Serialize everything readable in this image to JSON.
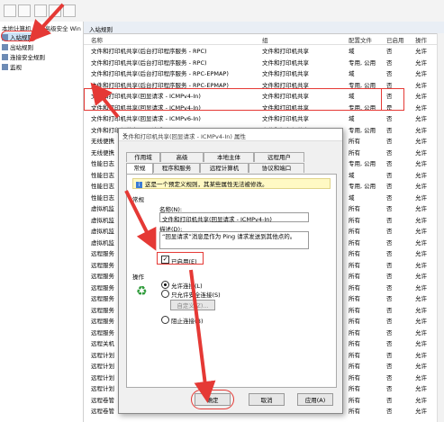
{
  "window": {
    "title": "高级安全 Win"
  },
  "tree": {
    "title": "本地计算机 上的高级安全 Win",
    "items": [
      {
        "label": "入站规则",
        "selected": true
      },
      {
        "label": "出站规则",
        "selected": false
      },
      {
        "label": "连接安全规则",
        "selected": false
      },
      {
        "label": "监视",
        "selected": false
      }
    ]
  },
  "main": {
    "header": "入站规则",
    "columns": {
      "name": "名称",
      "group": "组",
      "profile": "配置文件",
      "enabled": "已启用",
      "action": "操作"
    },
    "rows": [
      {
        "name": "文件和打印机共享(后台打印程序服务 - RPC)",
        "group": "文件和打印机共享",
        "profile": "域",
        "enabled": "否",
        "action": "允许"
      },
      {
        "name": "文件和打印机共享(后台打印程序服务 - RPC)",
        "group": "文件和打印机共享",
        "profile": "专用, 公用",
        "enabled": "否",
        "action": "允许"
      },
      {
        "name": "文件和打印机共享(后台打印程序服务 - RPC-EPMAP)",
        "group": "文件和打印机共享",
        "profile": "域",
        "enabled": "否",
        "action": "允许"
      },
      {
        "name": "文件和打印机共享(后台打印程序服务 - RPC-EPMAP)",
        "group": "文件和打印机共享",
        "profile": "专用, 公用",
        "enabled": "否",
        "action": "允许"
      },
      {
        "name": "文件和打印机共享(回显请求 - ICMPv4-In)",
        "group": "文件和打印机共享",
        "profile": "域",
        "enabled": "否",
        "action": "允许"
      },
      {
        "name": "文件和打印机共享(回显请求 - ICMPv4-In)",
        "group": "文件和打印机共享",
        "profile": "专用, 公用",
        "enabled": "是",
        "action": "允许"
      },
      {
        "name": "文件和打印机共享(回显请求 - ICMPv6-In)",
        "group": "文件和打印机共享",
        "profile": "域",
        "enabled": "否",
        "action": "允许"
      },
      {
        "name": "文件和打印机共享(回显请求 - ICMPv6-In)",
        "group": "文件和打印机共享",
        "profile": "专用, 公用",
        "enabled": "否",
        "action": "允许"
      },
      {
        "name": "无线便携",
        "group": "",
        "profile": "所有",
        "enabled": "否",
        "action": "允许"
      },
      {
        "name": "无线便携",
        "group": "",
        "profile": "所有",
        "enabled": "否",
        "action": "允许"
      },
      {
        "name": "性能日志",
        "group": "",
        "profile": "专用, 公用",
        "enabled": "否",
        "action": "允许"
      },
      {
        "name": "性能日志",
        "group": "",
        "profile": "域",
        "enabled": "否",
        "action": "允许"
      },
      {
        "name": "性能日志",
        "group": "",
        "profile": "专用, 公用",
        "enabled": "否",
        "action": "允许"
      },
      {
        "name": "性能日志",
        "group": "",
        "profile": "域",
        "enabled": "否",
        "action": "允许"
      },
      {
        "name": "虚拟机监",
        "group": "",
        "profile": "所有",
        "enabled": "否",
        "action": "允许"
      },
      {
        "name": "虚拟机监",
        "group": "",
        "profile": "所有",
        "enabled": "否",
        "action": "允许"
      },
      {
        "name": "虚拟机监",
        "group": "",
        "profile": "所有",
        "enabled": "否",
        "action": "允许"
      },
      {
        "name": "虚拟机监",
        "group": "",
        "profile": "所有",
        "enabled": "否",
        "action": "允许"
      },
      {
        "name": "远程服务",
        "group": "",
        "profile": "所有",
        "enabled": "否",
        "action": "允许"
      },
      {
        "name": "远程服务",
        "group": "",
        "profile": "所有",
        "enabled": "否",
        "action": "允许"
      },
      {
        "name": "远程服务",
        "group": "",
        "profile": "所有",
        "enabled": "否",
        "action": "允许"
      },
      {
        "name": "远程服务",
        "group": "",
        "profile": "所有",
        "enabled": "否",
        "action": "允许"
      },
      {
        "name": "远程服务",
        "group": "",
        "profile": "所有",
        "enabled": "否",
        "action": "允许"
      },
      {
        "name": "远程服务",
        "group": "",
        "profile": "所有",
        "enabled": "否",
        "action": "允许"
      },
      {
        "name": "远程服务",
        "group": "",
        "profile": "所有",
        "enabled": "否",
        "action": "允许"
      },
      {
        "name": "远程服务",
        "group": "",
        "profile": "所有",
        "enabled": "否",
        "action": "允许"
      },
      {
        "name": "远程关机",
        "group": "",
        "profile": "所有",
        "enabled": "否",
        "action": "允许"
      },
      {
        "name": "远程计划",
        "group": "",
        "profile": "所有",
        "enabled": "否",
        "action": "允许"
      },
      {
        "name": "远程计划",
        "group": "",
        "profile": "所有",
        "enabled": "否",
        "action": "允许"
      },
      {
        "name": "远程计划",
        "group": "",
        "profile": "所有",
        "enabled": "否",
        "action": "允许"
      },
      {
        "name": "远程计划",
        "group": "",
        "profile": "所有",
        "enabled": "否",
        "action": "允许"
      },
      {
        "name": "远程卷管",
        "group": "",
        "profile": "所有",
        "enabled": "否",
        "action": "允许"
      },
      {
        "name": "远程卷管",
        "group": "",
        "profile": "所有",
        "enabled": "否",
        "action": "允许"
      }
    ]
  },
  "dialog": {
    "title": "文件和打印机共享(回显请求 - ICMPv4-In) 属性",
    "close": "✕",
    "tabs_top": [
      "作用域",
      "高级",
      "本地主体",
      "远程用户"
    ],
    "tabs_bottom": [
      "常规",
      "程序和服务",
      "远程计算机",
      "协议和端口"
    ],
    "info": "这是一个预定义规则，其某些属性无法被修改。",
    "general_label": "常规",
    "name_label": "名称(N):",
    "name_value": "文件和打印机共享(回显请求 - ICMPv4-In)",
    "desc_label": "描述(D):",
    "desc_value": "“回显请求”消息是作为 Ping 请求发送到其他点的。",
    "enabled_label": "已启用(E)",
    "enabled": true,
    "action_label": "操作",
    "actions": [
      {
        "label": "允许连接(L)",
        "checked": true
      },
      {
        "label": "只允许安全连接(S)",
        "checked": false
      },
      {
        "label": "阻止连接(B)",
        "checked": false
      }
    ],
    "custom_button": "自定义(Z)...",
    "ok": "确定",
    "cancel": "取消",
    "apply": "应用(A)"
  },
  "colors": {
    "highlight": "#e53935",
    "selection": "#cde3f7"
  }
}
